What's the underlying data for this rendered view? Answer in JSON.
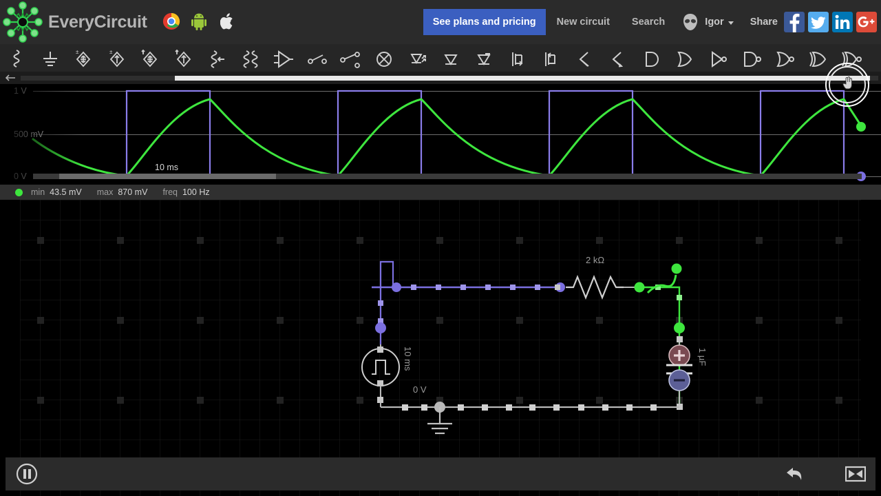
{
  "app": {
    "brand": "EveryCircuit",
    "logo_icon": "everycircuit-logo-icon"
  },
  "header": {
    "platform_icons": [
      {
        "name": "chrome-icon",
        "label": "Chrome"
      },
      {
        "name": "android-icon",
        "label": "Android"
      },
      {
        "name": "apple-icon",
        "label": "Apple"
      }
    ],
    "pricing_button": "See plans and pricing",
    "new_circuit": "New circuit",
    "search": "Search",
    "user": "Igor",
    "user_avatar_icon": "alien-avatar-icon",
    "caret_icon": "chevron-down-icon",
    "share_label": "Share",
    "share_buttons": [
      {
        "name": "facebook-share-button",
        "glyph": "f",
        "color": "#3b5998"
      },
      {
        "name": "twitter-share-button",
        "glyph": "ᴠ",
        "color": "#55acee"
      },
      {
        "name": "linkedin-share-button",
        "glyph": "in",
        "color": "#0077b5"
      },
      {
        "name": "googleplus-share-button",
        "glyph": "g+",
        "color": "#dd4b39"
      }
    ]
  },
  "toolbar": {
    "items": [
      {
        "name": "tool-resistor",
        "label": "Resistor"
      },
      {
        "name": "tool-ground",
        "label": "Ground"
      },
      {
        "name": "tool-dc-voltage-source",
        "label": "DC voltage source"
      },
      {
        "name": "tool-dc-current-source",
        "label": "DC current source"
      },
      {
        "name": "tool-ac-voltage-source",
        "label": "AC voltage source"
      },
      {
        "name": "tool-ac-current-source",
        "label": "AC current source"
      },
      {
        "name": "tool-variable-resistor",
        "label": "Variable resistor"
      },
      {
        "name": "tool-inductor",
        "label": "Inductor"
      },
      {
        "name": "tool-opamp",
        "label": "Op amp"
      },
      {
        "name": "tool-switch",
        "label": "Switch"
      },
      {
        "name": "tool-spdt-switch",
        "label": "SPDT switch"
      },
      {
        "name": "tool-lamp",
        "label": "Lamp"
      },
      {
        "name": "tool-led",
        "label": "LED"
      },
      {
        "name": "tool-npn-transistor",
        "label": "NPN transistor"
      },
      {
        "name": "tool-pnp-transistor",
        "label": "PNP transistor"
      },
      {
        "name": "tool-nmos-transistor",
        "label": "NMOS transistor"
      },
      {
        "name": "tool-pmos-transistor",
        "label": "PMOS transistor"
      },
      {
        "name": "tool-scr",
        "label": "SCR"
      },
      {
        "name": "tool-triac",
        "label": "Triac"
      },
      {
        "name": "tool-and-gate",
        "label": "AND gate"
      },
      {
        "name": "tool-or-gate",
        "label": "OR gate"
      },
      {
        "name": "tool-not-gate",
        "label": "NOT gate"
      },
      {
        "name": "tool-nand-gate",
        "label": "NAND gate"
      },
      {
        "name": "tool-nor-gate",
        "label": "NOR gate"
      },
      {
        "name": "tool-xor-gate",
        "label": "XOR gate"
      },
      {
        "name": "tool-xnor-gate",
        "label": "XNOR gate"
      }
    ]
  },
  "scope": {
    "back_icon": "back-arrow-icon",
    "y_labels": [
      "1 V",
      "500 mV",
      "0 V"
    ],
    "time_label": "10 ms",
    "stats": {
      "trace_color": "#3ee63e",
      "min_key": "min",
      "min_value": "43.5 mV",
      "max_key": "max",
      "max_value": "870 mV",
      "freq_key": "freq",
      "freq_value": "100 Hz"
    }
  },
  "chart_data": {
    "type": "line",
    "title": "",
    "xlabel": "10 ms",
    "ylabel": "",
    "ylim": [
      0,
      1
    ],
    "ytick_labels": [
      "1 V",
      "500 mV",
      "0 V"
    ],
    "ytick_values": [
      1,
      0.5,
      0
    ],
    "grid": true,
    "legend": "none",
    "series": [
      {
        "name": "Source square wave",
        "color": "#8a7dea",
        "kind": "square",
        "period_ms": 10,
        "high_v": 1.0,
        "low_v": 0.0,
        "duty": 0.45
      },
      {
        "name": "Capacitor voltage",
        "color": "#3ee63e",
        "kind": "rc-exponential",
        "min_v": 0.0435,
        "max_v": 0.87,
        "freq_hz": 100,
        "tau_ms": 2
      }
    ]
  },
  "circuit": {
    "source_label": "10 ms",
    "ground_label": "0 V",
    "resistor_label": "2 kΩ",
    "capacitor_label": "1 µF",
    "node_colors": {
      "source_node": "#7b6fe0",
      "output_node": "#3ee63e",
      "ground_node": "#b8b8b8"
    }
  },
  "bottom": {
    "pause_icon": "pause-button-icon",
    "undo_icon": "undo-arrow-icon",
    "fit_icon": "fit-to-screen-icon"
  }
}
